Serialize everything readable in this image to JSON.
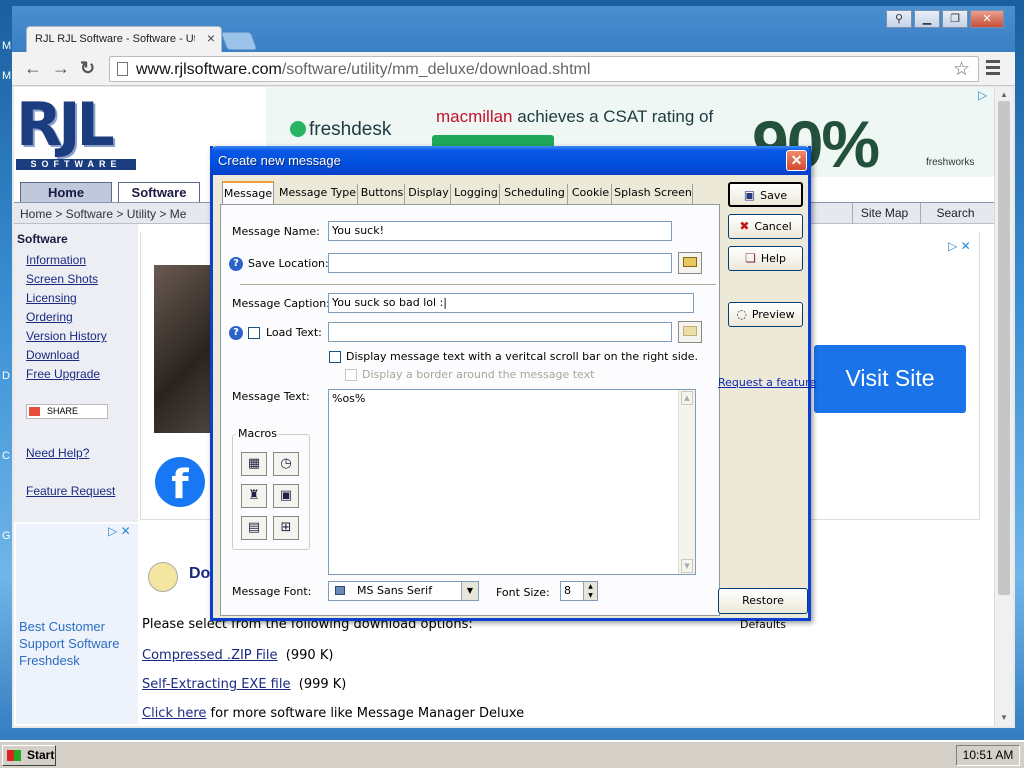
{
  "browser": {
    "tab_title": "RJL RJL Software - Software - Util",
    "url_domain": "www.rjlsoftware.com",
    "url_path": "/software/utility/mm_deluxe/download.shtml"
  },
  "site": {
    "logo_big": "RJL",
    "logo_small": "SOFTWARE",
    "nav_tabs": [
      "Home",
      "Software"
    ],
    "breadcrumb": "Home > Software > Utility > Me",
    "top_links": [
      "Site Map",
      "Search"
    ],
    "left_heading": "Software",
    "left_links": [
      "Information",
      "Screen Shots",
      "Licensing",
      "Ordering",
      "Version History",
      "Download",
      "Free Upgrade"
    ],
    "share_label": "SHARE",
    "need_help": "Need Help?",
    "feature_request": "Feature Request",
    "download_heading": "Do",
    "download_intro": "Please select from the following download options:",
    "downloads": [
      {
        "link": "Compressed .ZIP File",
        "size": "(990 K)"
      },
      {
        "link": "Self-Extracting EXE file",
        "size": "(999 K)"
      }
    ],
    "more_link": "Click here",
    "more_text": "for more software like Message Manager Deluxe"
  },
  "ads": {
    "freshdesk_logo": "freshdesk",
    "headline_brand": "macmillan",
    "headline_rest": "achieves a CSAT rating of",
    "big_number": "90%",
    "freshworks": "freshworks",
    "left_ad_text": "Best Customer Support Software Freshdesk",
    "visit_site": "Visit Site"
  },
  "dialog": {
    "title": "Create new message",
    "tabs": [
      "Message",
      "Message Type",
      "Buttons",
      "Display",
      "Logging",
      "Scheduling",
      "Cookie",
      "Splash Screen"
    ],
    "message_name_label": "Message Name:",
    "message_name_value": "You suck!",
    "save_location_label": "Save Location:",
    "save_location_value": "",
    "message_caption_label": "Message Caption:",
    "message_caption_value": "You suck so bad lol :|",
    "load_text_label": "Load Text:",
    "load_text_value": "",
    "scrollbar_option": "Display message text with a veritcal scroll bar on the right side.",
    "border_option": "Display a border around the message text",
    "message_text_label": "Message Text:",
    "message_text_value": "%os%",
    "macros_label": "Macros",
    "font_label": "Message Font:",
    "font_value": "MS Sans Serif",
    "font_size_label": "Font Size:",
    "font_size_value": "8",
    "buttons": {
      "save": "Save",
      "cancel": "Cancel",
      "help": "Help",
      "preview": "Preview",
      "restore": "Restore Defaults"
    },
    "request_feature": "Request a feature"
  },
  "taskbar": {
    "start": "Start",
    "clock": "10:51 AM"
  }
}
